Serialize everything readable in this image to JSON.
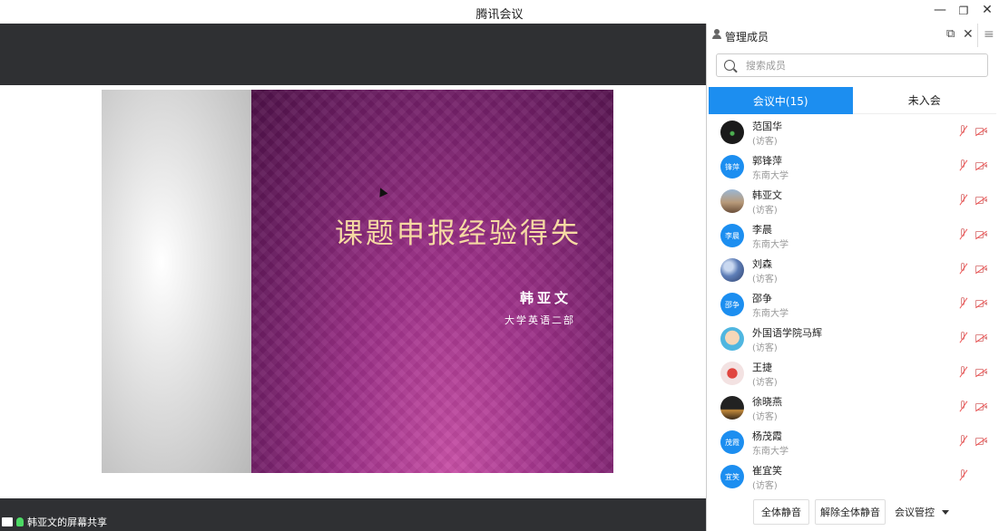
{
  "window": {
    "title": "腾讯会议",
    "minimize_icon": "—",
    "restore_icon": "❐",
    "close_icon": "✕"
  },
  "share": {
    "slide": {
      "title": "课题申报经验得失",
      "author": "韩亚文",
      "department": "大学英语二部"
    },
    "status_text": "韩亚文的屏幕共享"
  },
  "panel": {
    "title": "管理成员",
    "popout_icon": "⧉",
    "close_icon": "✕",
    "menu_icon": "≡",
    "search_placeholder": "搜索成员",
    "tabs": [
      {
        "label": "会议中(15)",
        "active": true
      },
      {
        "label": "未入会",
        "active": false
      }
    ],
    "members": [
      {
        "name": "范国华",
        "sub": "(访客)",
        "avatar": "photo-dark",
        "avatar_text": "",
        "avatar_color": "#1a1a1a",
        "mic_muted": true,
        "cam_off": true
      },
      {
        "name": "郭锋萍",
        "sub": "东南大学",
        "avatar": "initials",
        "avatar_text": "锋萍",
        "avatar_color": "#1c8ef0",
        "mic_muted": true,
        "cam_off": true
      },
      {
        "name": "韩亚文",
        "sub": "(访客)",
        "avatar": "photo-building",
        "avatar_text": "",
        "avatar_color": "#8a6f5a",
        "mic_muted": true,
        "cam_off": true
      },
      {
        "name": "李晨",
        "sub": "东南大学",
        "avatar": "initials",
        "avatar_text": "李晨",
        "avatar_color": "#1c8ef0",
        "mic_muted": true,
        "cam_off": true
      },
      {
        "name": "刘森",
        "sub": "(访客)",
        "avatar": "photo-blue",
        "avatar_text": "",
        "avatar_color": "#5f7fb8",
        "mic_muted": true,
        "cam_off": true
      },
      {
        "name": "邵争",
        "sub": "东南大学",
        "avatar": "initials",
        "avatar_text": "邵争",
        "avatar_color": "#1c8ef0",
        "mic_muted": true,
        "cam_off": true
      },
      {
        "name": "外国语学院马辉",
        "sub": "(访客)",
        "avatar": "photo-cartoon",
        "avatar_text": "",
        "avatar_color": "#4fb6e0",
        "mic_muted": true,
        "cam_off": true
      },
      {
        "name": "王捷",
        "sub": "(访客)",
        "avatar": "photo-red",
        "avatar_text": "",
        "avatar_color": "#f3e2e2",
        "mic_muted": true,
        "cam_off": true
      },
      {
        "name": "徐晓燕",
        "sub": "(访客)",
        "avatar": "photo-night",
        "avatar_text": "",
        "avatar_color": "#222222",
        "mic_muted": true,
        "cam_off": true
      },
      {
        "name": "杨茂霞",
        "sub": "东南大学",
        "avatar": "initials",
        "avatar_text": "茂霞",
        "avatar_color": "#1c8ef0",
        "mic_muted": true,
        "cam_off": true
      },
      {
        "name": "崔宜笑",
        "sub": "(访客)",
        "avatar": "initials",
        "avatar_text": "宜笑",
        "avatar_color": "#1c8ef0",
        "mic_muted": true,
        "cam_off": false
      }
    ],
    "footer": {
      "mute_all": "全体静音",
      "unmute_all": "解除全体静音",
      "meeting_control": "会议管控"
    }
  },
  "colors": {
    "accent": "#1c8ef0",
    "dark_bg": "#2f3033",
    "slide_purple": "#9a2f86",
    "slide_title": "#f5d9a3"
  }
}
